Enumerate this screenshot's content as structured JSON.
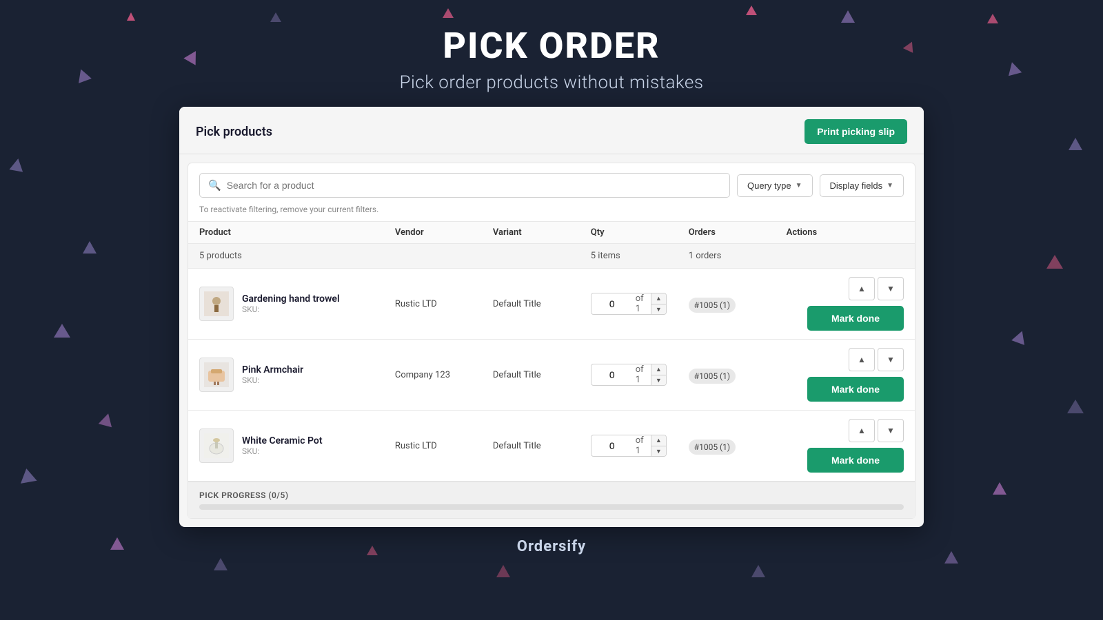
{
  "hero": {
    "title": "PICK ORDER",
    "subtitle": "Pick order products without mistakes"
  },
  "card": {
    "title": "Pick products",
    "print_btn_label": "Print picking slip"
  },
  "search": {
    "placeholder": "Search for a product",
    "filter_hint": "To reactivate filtering, remove your current filters.",
    "query_type_label": "Query type",
    "display_fields_label": "Display fields"
  },
  "table": {
    "columns": [
      "Product",
      "Vendor",
      "Variant",
      "Qty",
      "Orders",
      "Actions"
    ],
    "summary": {
      "products": "5 products",
      "qty": "5 items",
      "orders": "1 orders"
    },
    "rows": [
      {
        "name": "Gardening hand trowel",
        "sku": "SKU:",
        "vendor": "Rustic LTD",
        "variant": "Default Title",
        "qty_current": "0",
        "qty_total": "1",
        "order": "#1005 (1)"
      },
      {
        "name": "Pink Armchair",
        "sku": "SKU:",
        "vendor": "Company 123",
        "variant": "Default Title",
        "qty_current": "0",
        "qty_total": "1",
        "order": "#1005 (1)"
      },
      {
        "name": "White Ceramic Pot",
        "sku": "SKU:",
        "vendor": "Rustic LTD",
        "variant": "Default Title",
        "qty_current": "0",
        "qty_total": "1",
        "order": "#1005 (1)"
      }
    ]
  },
  "progress": {
    "label": "PICK PROGRESS (0/5)",
    "percent": 0
  },
  "footer": {
    "brand": "Ordersify"
  },
  "buttons": {
    "mark_done": "Mark done",
    "chevron_up": "▲",
    "chevron_down": "▼"
  }
}
